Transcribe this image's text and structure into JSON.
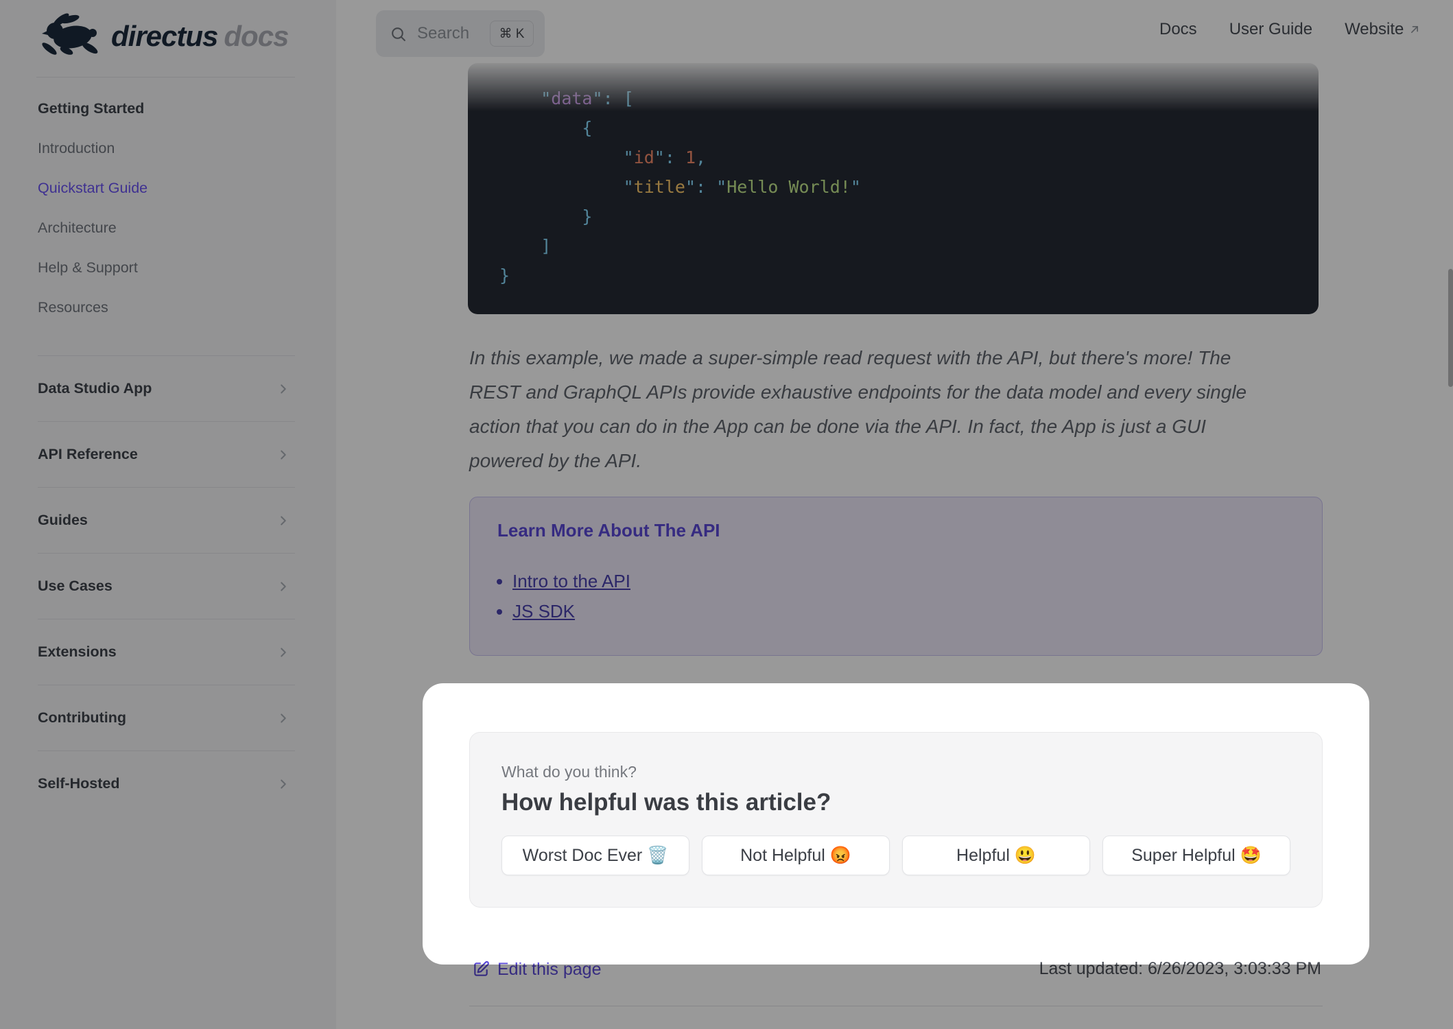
{
  "navbar": {
    "logo": {
      "primary": "directus",
      "secondary": "docs"
    },
    "search": {
      "label": "Search",
      "shortcut": "⌘ K"
    },
    "links": [
      {
        "label": "Docs",
        "external": false
      },
      {
        "label": "User Guide",
        "external": false
      },
      {
        "label": "Website",
        "external": true
      }
    ]
  },
  "sidebar": {
    "section": {
      "header": "Getting Started",
      "items": [
        {
          "label": "Introduction",
          "active": false
        },
        {
          "label": "Quickstart Guide",
          "active": true
        },
        {
          "label": "Architecture",
          "active": false
        },
        {
          "label": "Help & Support",
          "active": false
        },
        {
          "label": "Resources",
          "active": false
        }
      ]
    },
    "groups": [
      {
        "label": "Data Studio App"
      },
      {
        "label": "API Reference"
      },
      {
        "label": "Guides"
      },
      {
        "label": "Use Cases"
      },
      {
        "label": "Extensions"
      },
      {
        "label": "Contributing"
      },
      {
        "label": "Self-Hosted"
      }
    ]
  },
  "code_block": {
    "background": "#262a34",
    "colors": {
      "plain": "#a6accd",
      "punct": "#89ddff",
      "key_data": "#c792ea",
      "key_id": "#f78c6c",
      "key_title": "#ffcb6b",
      "num": "#f78c6c",
      "str": "#c3e88d"
    },
    "lines": [
      [
        [
          "    ",
          "plain"
        ],
        [
          "\"",
          "punct"
        ],
        [
          "data",
          "key_data"
        ],
        [
          "\"",
          "punct"
        ],
        [
          ":",
          "punct"
        ],
        [
          " ",
          "plain"
        ],
        [
          "[",
          "punct"
        ]
      ],
      [
        [
          "        ",
          "plain"
        ],
        [
          "{",
          "punct"
        ]
      ],
      [
        [
          "            ",
          "plain"
        ],
        [
          "\"",
          "punct"
        ],
        [
          "id",
          "key_id"
        ],
        [
          "\"",
          "punct"
        ],
        [
          ":",
          "punct"
        ],
        [
          " ",
          "plain"
        ],
        [
          "1",
          "num"
        ],
        [
          ",",
          "punct"
        ]
      ],
      [
        [
          "            ",
          "plain"
        ],
        [
          "\"",
          "punct"
        ],
        [
          "title",
          "key_title"
        ],
        [
          "\"",
          "punct"
        ],
        [
          ":",
          "punct"
        ],
        [
          " ",
          "plain"
        ],
        [
          "\"",
          "punct"
        ],
        [
          "Hello World!",
          "str"
        ],
        [
          "\"",
          "punct"
        ]
      ],
      [
        [
          "        ",
          "plain"
        ],
        [
          "}",
          "punct"
        ]
      ],
      [
        [
          "    ",
          "plain"
        ],
        [
          "]",
          "punct"
        ]
      ],
      [
        [
          "}",
          "punct"
        ]
      ]
    ]
  },
  "paragraph_lines": [
    "In this example, we made a super-simple read request with the API, but there's more! The",
    "REST and GraphQL APIs provide exhaustive endpoints for the data model and every single",
    "action that you can do in the App can be done via the API. In fact, the App is just a GUI",
    "powered by the API."
  ],
  "callout": {
    "title": "Learn More About The API",
    "links": [
      "Intro to the API",
      "JS SDK"
    ]
  },
  "feedback": {
    "kicker": "What do you think?",
    "question": "How helpful was this article?",
    "options": [
      "Worst Doc Ever 🗑️",
      "Not Helpful 😡",
      "Helpful 😃",
      "Super Helpful 🤩"
    ]
  },
  "footer": {
    "edit_link": "Edit this page",
    "last_updated": "Last updated: 6/26/2023, 3:03:33 PM"
  },
  "colors": {
    "brand": "#6644ff",
    "sidebar_bg": "#f6f6f7",
    "overlay": "rgba(0,0,0,0.40)"
  }
}
